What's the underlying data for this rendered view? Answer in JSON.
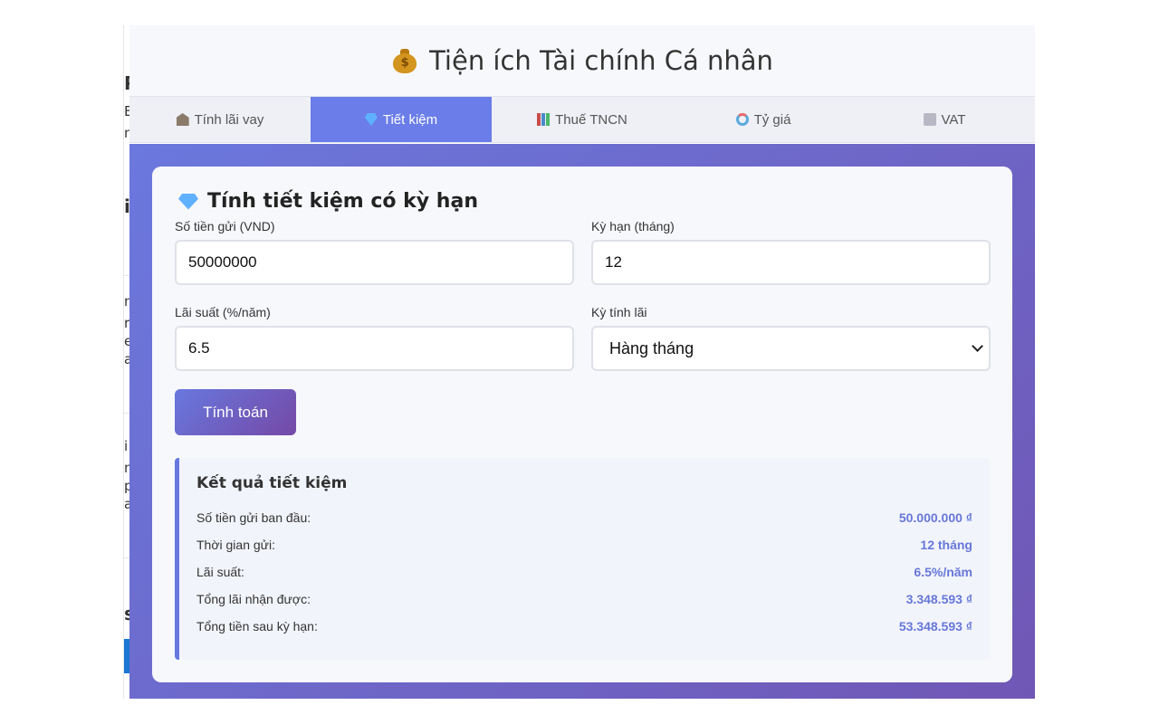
{
  "background_page": {
    "fragments": [
      "P",
      "E",
      "m",
      "i",
      "n",
      "r",
      "e",
      "a",
      "i",
      "n",
      "p",
      "a",
      "s",
      "tr"
    ]
  },
  "header": {
    "icon": "money-bag-icon",
    "title": "Tiện ích Tài chính Cá nhân"
  },
  "tabs": [
    {
      "icon": "bank-icon",
      "label": "Tính lãi vay",
      "active": false
    },
    {
      "icon": "gem-icon",
      "label": "Tiết kiệm",
      "active": true
    },
    {
      "icon": "bar-chart-icon",
      "label": "Thuế TNCN",
      "active": false
    },
    {
      "icon": "exchange-icon",
      "label": "Tỷ giá",
      "active": false
    },
    {
      "icon": "document-icon",
      "label": "VAT",
      "active": false
    }
  ],
  "form": {
    "title": "Tính tiết kiệm có kỳ hạn",
    "deposit_label": "Số tiền gửi (VND)",
    "deposit_value": "50000000",
    "term_label": "Kỳ hạn (tháng)",
    "term_value": "12",
    "rate_label": "Lãi suất (%/năm)",
    "rate_value": "6.5",
    "period_label": "Kỳ tính lãi",
    "period_value": "Hàng tháng",
    "submit_label": "Tính toán"
  },
  "result": {
    "title": "Kết quả tiết kiệm",
    "rows": [
      {
        "label": "Số tiền gửi ban đầu:",
        "value": "50.000.000 ₫"
      },
      {
        "label": "Thời gian gửi:",
        "value": "12 tháng"
      },
      {
        "label": "Lãi suất:",
        "value": "6.5%/năm"
      },
      {
        "label": "Tổng lãi nhận được:",
        "value": "3.348.593 ₫"
      },
      {
        "label": "Tổng tiền sau kỳ hạn:",
        "value": "53.348.593 ₫"
      }
    ]
  },
  "colors": {
    "accent": "#6a7de8",
    "gradient_start": "#6b78dd",
    "gradient_end": "#7057b5",
    "value_text": "#6777d8"
  }
}
